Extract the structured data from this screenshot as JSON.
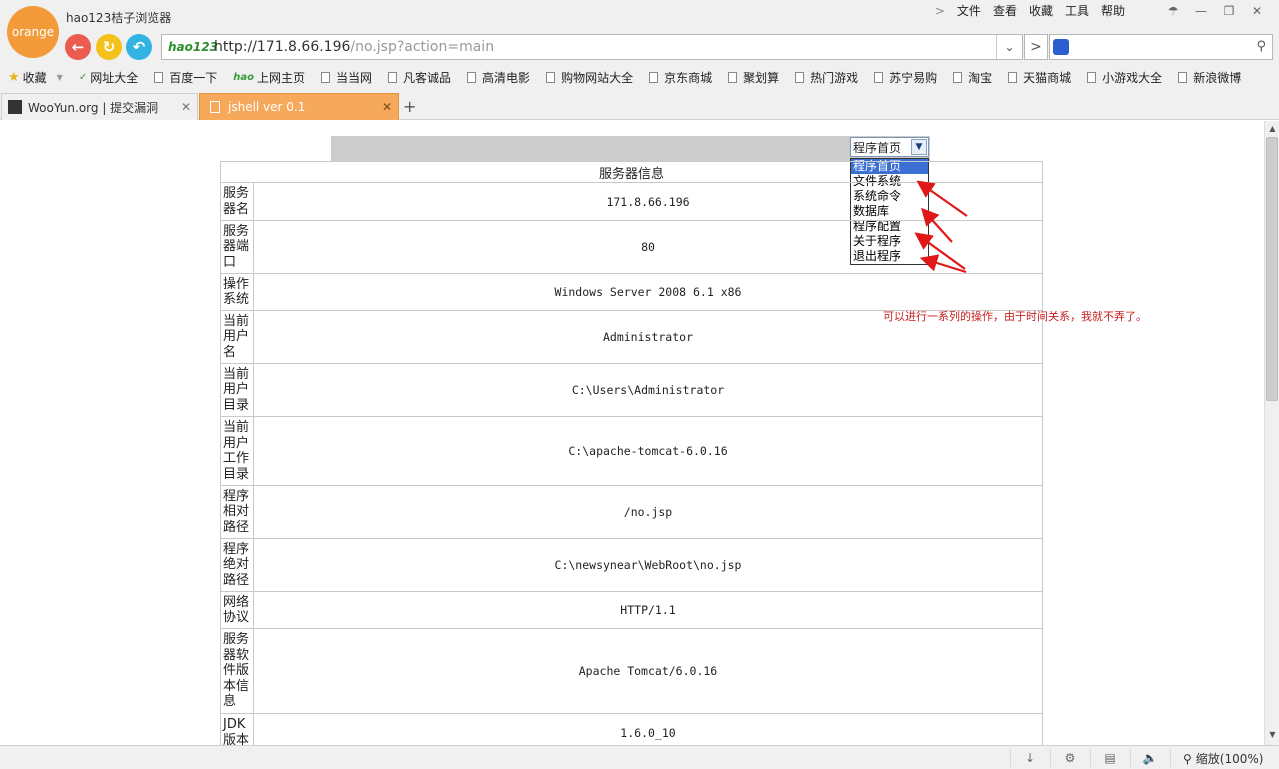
{
  "window": {
    "logo_text": "orange",
    "app_title": "hao123桔子浏览器",
    "menu": [
      "文件",
      "查看",
      "收藏",
      "工具",
      "帮助"
    ]
  },
  "address_bar": {
    "badge": "hao123",
    "url_host": "http://171.8.66.196",
    "url_path": "/no.jsp?action=main"
  },
  "bookmarks": {
    "favorites_label": "收藏",
    "items": [
      "网址大全",
      "百度一下",
      "上网主页",
      "当当网",
      "凡客诚品",
      "高清电影",
      "购物网站大全",
      "京东商城",
      "聚划算",
      "热门游戏",
      "苏宁易购",
      "淘宝",
      "天猫商城",
      "小游戏大全",
      "新浪微博"
    ]
  },
  "tabs": [
    {
      "title": "WooYun.org | 提交漏洞",
      "active": false
    },
    {
      "title": "jshell ver 0.1",
      "active": true
    }
  ],
  "page": {
    "select": {
      "value": "程序首页",
      "options": [
        "程序首页",
        "文件系统",
        "系统命令",
        "数据库",
        "程序配置",
        "关于程序",
        "退出程序"
      ]
    },
    "table_title": "服务器信息",
    "rows": [
      {
        "label": "服务器名",
        "value": "171.8.66.196"
      },
      {
        "label": "服务器端口",
        "value": "80"
      },
      {
        "label": "操作系统",
        "value": "Windows Server 2008 6.1 x86"
      },
      {
        "label": "当前用户名",
        "value": "Administrator"
      },
      {
        "label": "当前用户目录",
        "value": "C:\\Users\\Administrator"
      },
      {
        "label": "当前用户工作目录",
        "value": "C:\\apache-tomcat-6.0.16"
      },
      {
        "label": "程序相对路径",
        "value": "/no.jsp"
      },
      {
        "label": "程序绝对路径",
        "value": "C:\\newsynear\\WebRoot\\no.jsp"
      },
      {
        "label": "网络协议",
        "value": "HTTP/1.1"
      },
      {
        "label": "服务器软件版本信息",
        "value": "Apache Tomcat/6.0.16"
      },
      {
        "label": "JDK版本",
        "value": "1.6.0_10"
      }
    ],
    "annotation": "可以进行一系列的操作，由于时间关系，我就不弄了。"
  },
  "status_bar": {
    "zoom_label": "缩放(100%)"
  },
  "colors": {
    "tab_active": "#f6a95a",
    "annotation": "#c81f1f",
    "dropdown_selected": "#3b6fd3"
  }
}
